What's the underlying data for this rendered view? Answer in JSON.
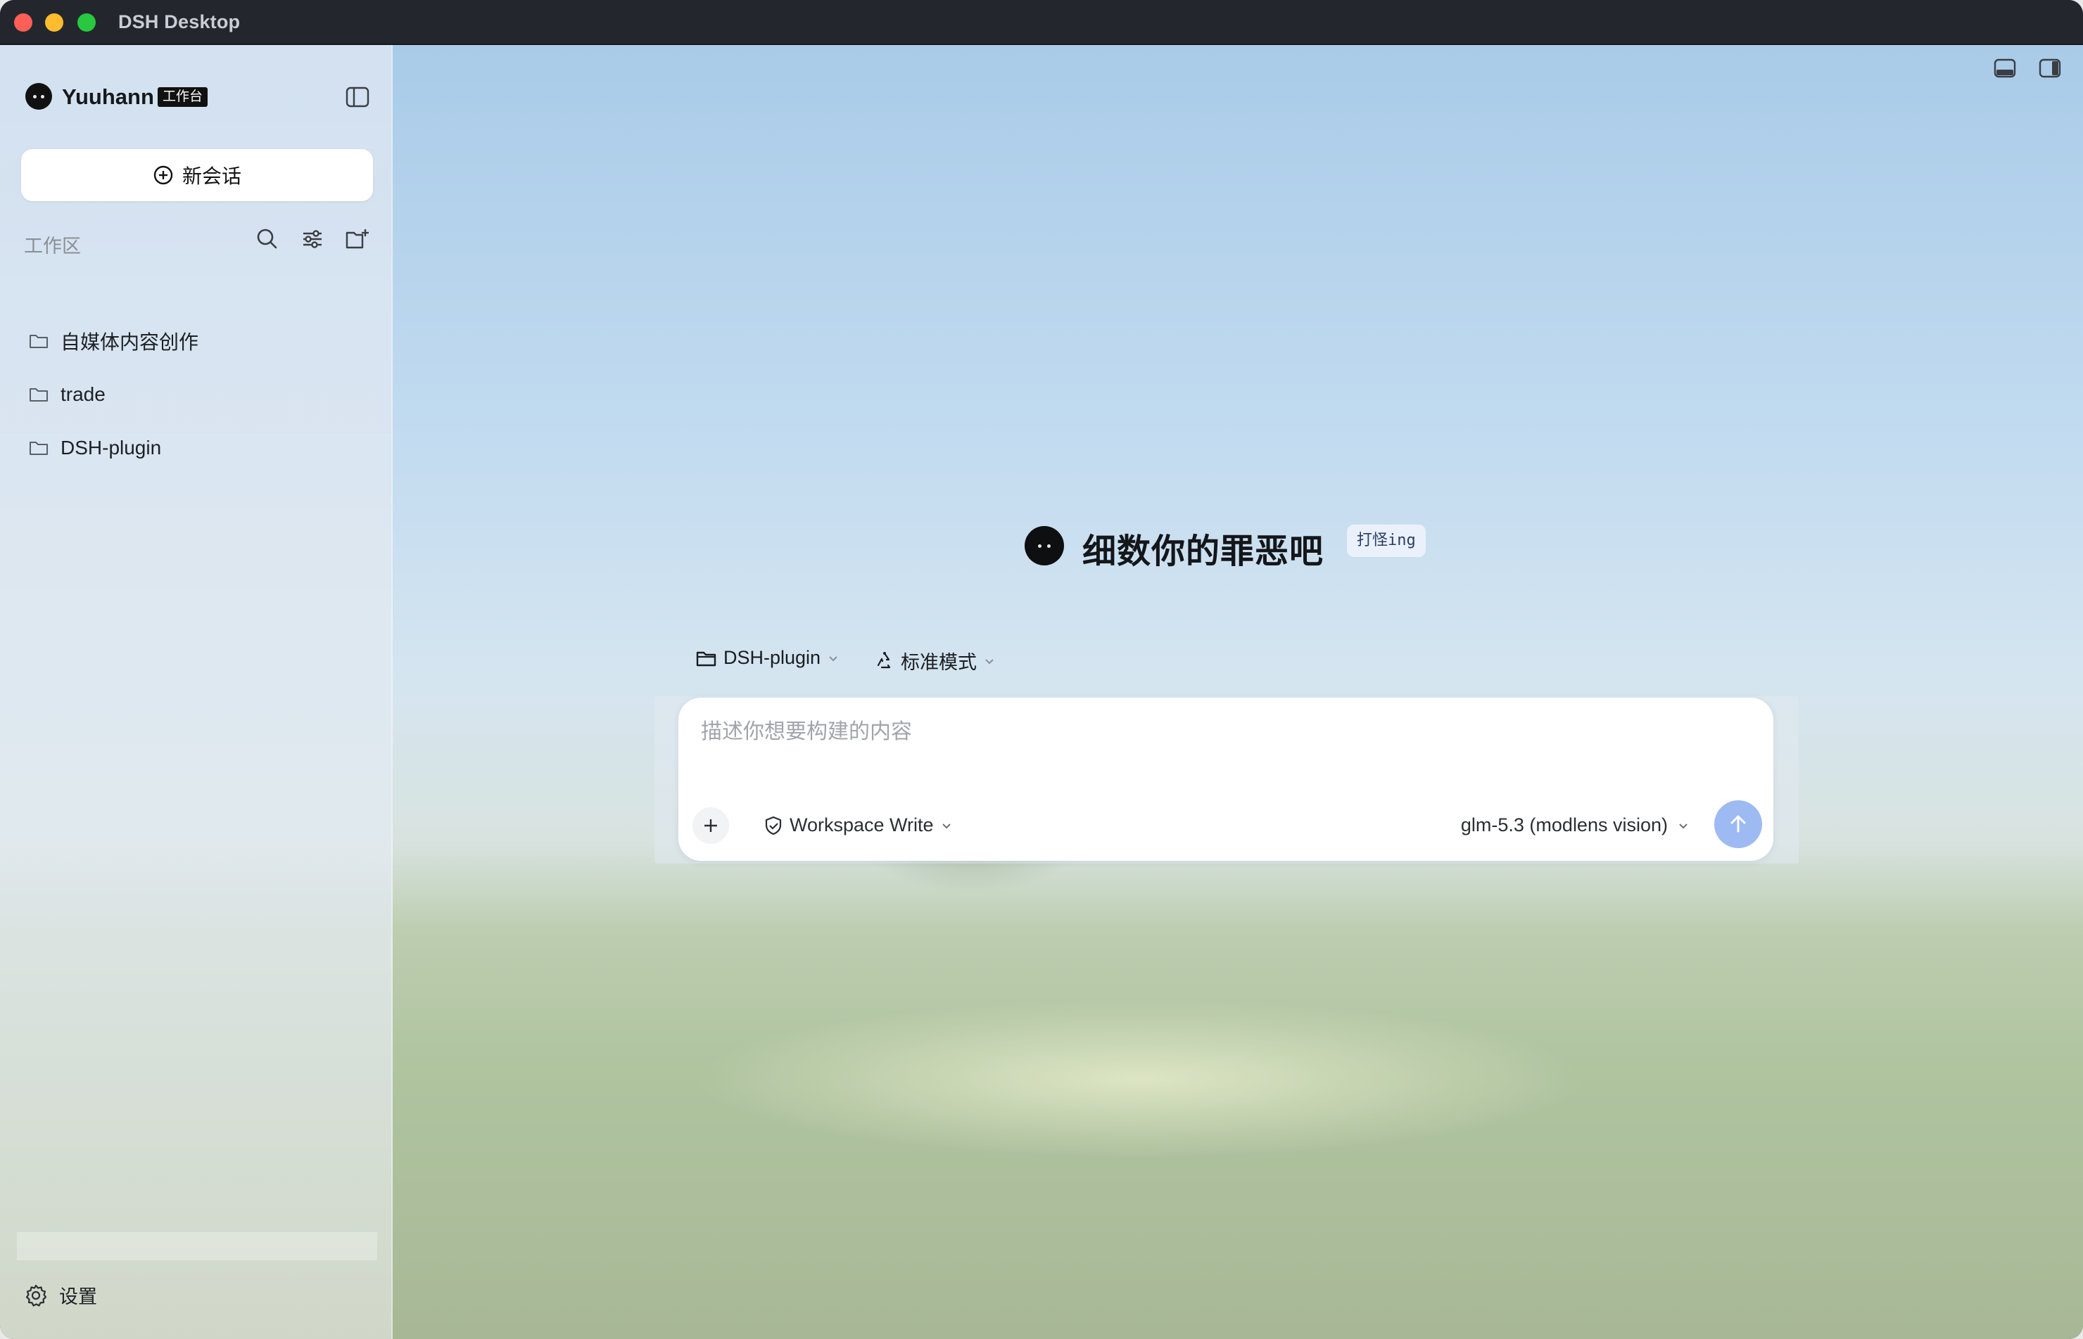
{
  "window": {
    "title": "DSH Desktop"
  },
  "sidebar": {
    "user_name": "Yuuhann",
    "user_badge": "工作台",
    "new_chat_label": "新会话",
    "workspace_label": "工作区",
    "workspaces": [
      {
        "label": "自媒体内容创作"
      },
      {
        "label": "trade"
      },
      {
        "label": "DSH-plugin"
      }
    ],
    "settings_label": "设置"
  },
  "hero": {
    "title": "细数你的罪恶吧",
    "badge": "打怪ing"
  },
  "selectors": {
    "project": "DSH-plugin",
    "mode": "标准模式"
  },
  "composer": {
    "placeholder": "描述你想要构建的内容",
    "permission": "Workspace Write",
    "model": "glm-5.3 (modlens vision)"
  },
  "colors": {
    "accent_send": "#9dbaf3",
    "badge_dark": "#111111"
  },
  "icons": [
    "close-dot",
    "minimize-dot",
    "maximize-dot",
    "sidebar-toggle-icon",
    "plus-circle-icon",
    "search-icon",
    "sliders-icon",
    "folder-add-icon",
    "folder-icon",
    "gear-icon",
    "bottom-panel-icon",
    "right-panel-icon",
    "folder-open-icon",
    "chevron-down-icon",
    "mode-cycle-icon",
    "shield-check-icon",
    "plus-icon",
    "arrow-up-icon"
  ]
}
